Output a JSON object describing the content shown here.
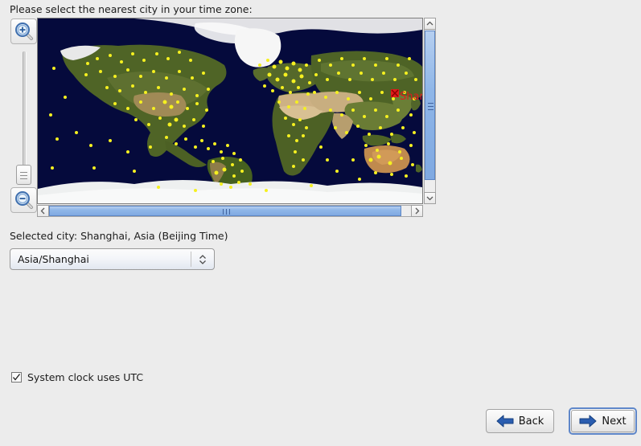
{
  "prompt": {
    "text": "Please select the nearest city in your time zone:"
  },
  "map": {
    "zoom_in_icon": "magnifier-plus-icon",
    "zoom_out_icon": "magnifier-minus-icon",
    "marker": {
      "label": "Shanghai",
      "color": "#e01b1b",
      "icon": "red-x-marker-icon"
    },
    "ocean_color": "#050a3c",
    "land_color": "#4a5f23",
    "desert_color": "#c9b184",
    "ice_color": "#f2f2f2",
    "city_dot_color": "#f5f020"
  },
  "scrollbars": {
    "vertical": {
      "up_icon": "chevron-up-icon",
      "down_icon": "chevron-down-icon"
    },
    "horizontal": {
      "left_icon": "chevron-left-icon",
      "right_icon": "chevron-right-icon"
    },
    "thumb_color": "#8fb6e8"
  },
  "selection": {
    "selected_city_text": "Selected city: Shanghai, Asia (Beijing Time)",
    "timezone_value": "Asia/Shanghai",
    "timezone_arrow_icon": "up-down-chevron-icon"
  },
  "options": {
    "utc_label": "System clock uses UTC",
    "utc_checked": true,
    "check_icon": "checkmark-icon"
  },
  "footer": {
    "back_label": "Back",
    "back_icon": "arrow-left-icon",
    "next_label": "Next",
    "next_icon": "arrow-right-icon",
    "accent_color": "#2a5db0"
  }
}
